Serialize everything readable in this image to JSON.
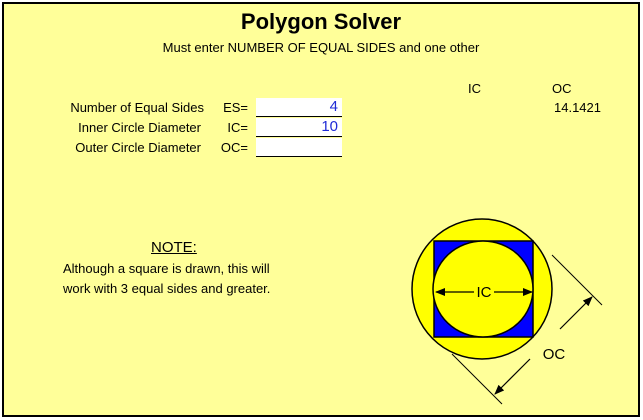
{
  "title": "Polygon Solver",
  "subtitle": "Must enter NUMBER OF EQUAL SIDES and one other",
  "results": {
    "ic_header": "IC",
    "oc_header": "OC",
    "oc_value": "14.1421"
  },
  "inputs": [
    {
      "label": "Number of Equal Sides",
      "code": "ES=",
      "value": "4"
    },
    {
      "label": "Inner Circle Diameter",
      "code": "IC=",
      "value": "10"
    },
    {
      "label": "Outer Circle Diameter",
      "code": "OC=",
      "value": ""
    }
  ],
  "note": {
    "title": "NOTE:",
    "line1": "Although a square is drawn, this will",
    "line2": "work with 3 equal sides and greater."
  },
  "diagram": {
    "ic_label": "IC",
    "oc_label": "OC",
    "colors": {
      "background": "#ffff99",
      "circle_fill": "#ffff00",
      "square_fill": "#0000ff",
      "outline": "#000000",
      "input_text": "#1f2bd6"
    }
  }
}
